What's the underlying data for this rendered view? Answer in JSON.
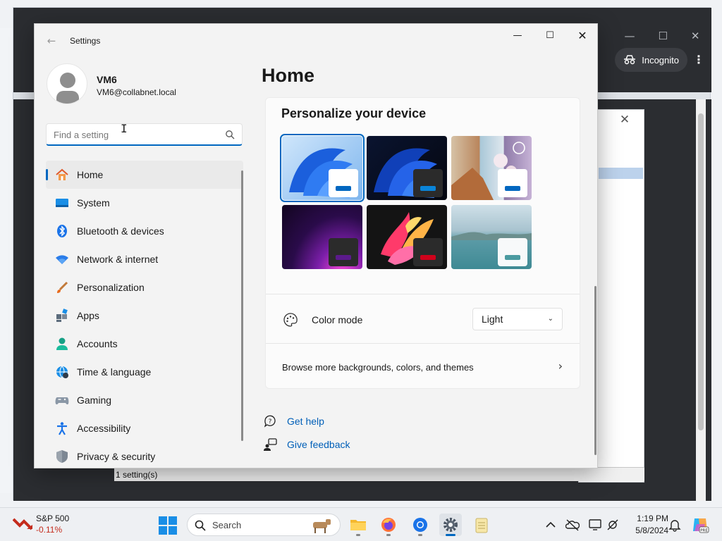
{
  "window": {
    "title": "Settings"
  },
  "user": {
    "name": "VM6",
    "email": "VM6@collabnet.local"
  },
  "search": {
    "placeholder": "Find a setting",
    "value": ""
  },
  "nav": {
    "items": [
      {
        "label": "Home",
        "icon": "home-icon",
        "active": true
      },
      {
        "label": "System",
        "icon": "system-icon"
      },
      {
        "label": "Bluetooth & devices",
        "icon": "bluetooth-icon"
      },
      {
        "label": "Network & internet",
        "icon": "wifi-icon"
      },
      {
        "label": "Personalization",
        "icon": "brush-icon"
      },
      {
        "label": "Apps",
        "icon": "apps-icon"
      },
      {
        "label": "Accounts",
        "icon": "account-icon"
      },
      {
        "label": "Time & language",
        "icon": "globe-clock-icon"
      },
      {
        "label": "Gaming",
        "icon": "gamepad-icon"
      },
      {
        "label": "Accessibility",
        "icon": "accessibility-icon"
      },
      {
        "label": "Privacy & security",
        "icon": "shield-icon"
      }
    ]
  },
  "main": {
    "title": "Home",
    "personalize": {
      "title": "Personalize your device",
      "wallpapers": [
        {
          "name": "windows-light-bloom",
          "selected": true
        },
        {
          "name": "windows-dark-bloom"
        },
        {
          "name": "spotlight-collage"
        },
        {
          "name": "glow-purple"
        },
        {
          "name": "captured-motion"
        },
        {
          "name": "flow-lake"
        }
      ],
      "color_mode": {
        "label": "Color mode",
        "value": "Light"
      },
      "browse_label": "Browse more backgrounds, colors, and themes"
    },
    "links": [
      {
        "label": "Get help",
        "icon": "help-icon"
      },
      {
        "label": "Give feedback",
        "icon": "feedback-icon"
      }
    ]
  },
  "browser": {
    "incognito_label": "Incognito"
  },
  "background_dialog": {
    "status": "1 setting(s)"
  },
  "taskbar": {
    "stock": {
      "name": "S&P 500",
      "change": "-0.11%"
    },
    "search_label": "Search",
    "clock": {
      "time": "1:19 PM",
      "date": "5/8/2024"
    }
  },
  "colors": {
    "accent": "#0067c0",
    "link": "#005fb8",
    "negative": "#c42b1c"
  }
}
